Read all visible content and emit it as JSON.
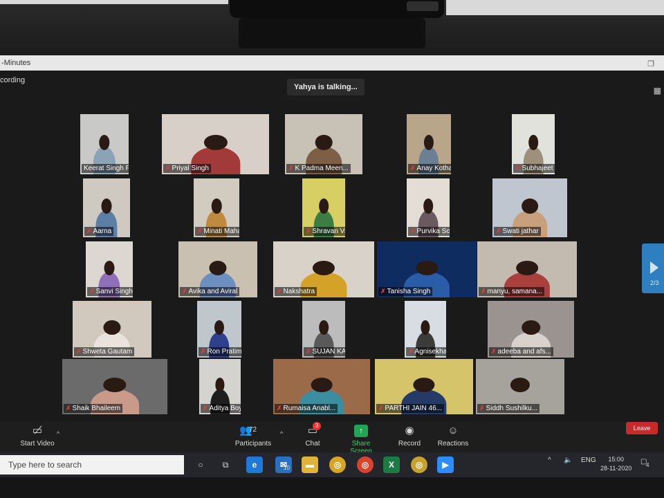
{
  "window": {
    "title": "-Minutes",
    "recording_label": "cording",
    "restore_icon": "restore-icon"
  },
  "talking_indicator": "Yahya is talking...",
  "page_indicator": "2/3",
  "participants": [
    {
      "name": "Keerat Singh Pongl...",
      "muted": false,
      "bg": "#c9c9c7",
      "shirt": "#8aa3b5"
    },
    {
      "name": "Priyal Singh",
      "muted": true,
      "bg": "#d9cfc9",
      "shirt": "#a33a3a"
    },
    {
      "name": "K Padma Meen...",
      "muted": true,
      "bg": "#c8c2b6",
      "shirt": "#7d5f45"
    },
    {
      "name": "Anay Kothawade",
      "muted": true,
      "bg": "#b9a58a",
      "shirt": "#6b7f95"
    },
    {
      "name": "Subhajeet Mitra",
      "muted": true,
      "bg": "#e2e2dd",
      "shirt": "#9d8f7a"
    },
    {
      "name": "Aarna",
      "muted": true,
      "bg": "#cfcac1",
      "shirt": "#5d7fa6"
    },
    {
      "name": "Minati Maharana",
      "muted": true,
      "bg": "#d2cbbf",
      "shirt": "#c08a3e"
    },
    {
      "name": "Shravan Vinu",
      "muted": true,
      "bg": "#d7cf64",
      "shirt": "#3c7d44"
    },
    {
      "name": "Purvika Soofa",
      "muted": true,
      "bg": "#e3ddd6",
      "shirt": "#6a5a60"
    },
    {
      "name": "Swati jathar",
      "muted": true,
      "bg": "#bfc6cf",
      "shirt": "#c8a07c"
    },
    {
      "name": "Sanvi Singh",
      "muted": true,
      "bg": "#dcd7d1",
      "shirt": "#8f6fb8"
    },
    {
      "name": "Avika and Aviral",
      "muted": true,
      "bg": "#c9c0b1",
      "shirt": "#6d8fc0"
    },
    {
      "name": "Nakshatra",
      "muted": true,
      "bg": "#d8d2c8",
      "shirt": "#d5a229"
    },
    {
      "name": "Tanisha Singh",
      "muted": true,
      "bg": "#0e2c60",
      "shirt": "#2a5ca8"
    },
    {
      "name": "manyu, samana...",
      "muted": true,
      "bg": "#c3bab0",
      "shirt": "#a8413e"
    },
    {
      "name": "Shweta Gautam",
      "muted": true,
      "bg": "#d1c9be",
      "shirt": "#e9e3dc"
    },
    {
      "name": "Ron Pratim Bora",
      "muted": true,
      "bg": "#bfc7cc",
      "shirt": "#2f3f8e"
    },
    {
      "name": "SUJAN KARTHIK",
      "muted": true,
      "bg": "#bcbcbc",
      "shirt": "#5a5a5a"
    },
    {
      "name": "Agnisekhar das",
      "muted": true,
      "bg": "#d7dde2",
      "shirt": "#3b3b3b"
    },
    {
      "name": "adeeba and afs...",
      "muted": true,
      "bg": "#9a9390",
      "shirt": "#d9d2cc"
    },
    {
      "name": "Shaik Bhaileem",
      "muted": true,
      "bg": "#6b6b6b",
      "shirt": "#c99a8a"
    },
    {
      "name": "Aditya Boyina",
      "muted": true,
      "bg": "#d5d3cf",
      "shirt": "#1e1e1e"
    },
    {
      "name": "Rumaisa Anabl...",
      "muted": true,
      "bg": "#9b6a49",
      "shirt": "#3a8ea0"
    },
    {
      "name": "PARTHI JAIN 46...",
      "muted": true,
      "bg": "#d6c46a",
      "shirt": "#253a66"
    },
    {
      "name": "Siddh Sushilku...",
      "muted": true,
      "bg": "#a6a29c",
      "shirt": "#a6a29c"
    }
  ],
  "toolbar": {
    "start_video": "Start Video",
    "participants_label": "Participants",
    "participants_count": "72",
    "chat_label": "Chat",
    "chat_badge": "3",
    "share_label": "Share Screen",
    "record_label": "Record",
    "reactions_label": "Reactions",
    "leave_label": "Leave"
  },
  "taskbar": {
    "search_placeholder": "Type here to search",
    "mail_badge": "10",
    "lang": "ENG",
    "time": "15:00",
    "date": "28-11-2020",
    "notification_count": "4"
  },
  "colors": {
    "accent_green": "#23a455",
    "leave_red": "#c52b2b",
    "page_blue": "#2d7fc0"
  }
}
